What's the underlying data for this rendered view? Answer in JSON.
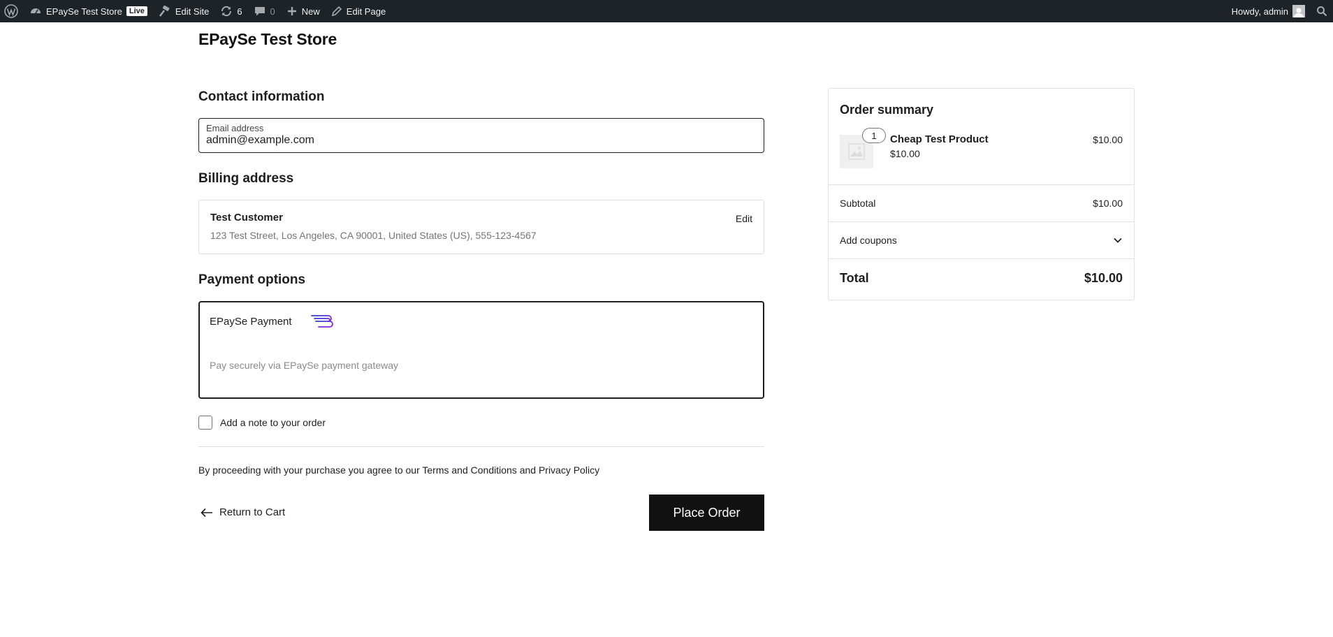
{
  "admin_bar": {
    "site_name": "EPaySe Test Store",
    "live_badge": "Live",
    "edit_site": "Edit Site",
    "updates_count": "6",
    "comments_count": "0",
    "new_label": "New",
    "edit_page": "Edit Page",
    "howdy": "Howdy, admin"
  },
  "store": {
    "title": "EPaySe Test Store"
  },
  "contact": {
    "heading": "Contact information",
    "email_label": "Email address",
    "email_value": "admin@example.com"
  },
  "billing": {
    "heading": "Billing address",
    "name": "Test Customer",
    "address": "123 Test Street, Los Angeles, CA 90001, United States (US), 555-123-4567",
    "edit_label": "Edit"
  },
  "payment": {
    "heading": "Payment options",
    "method_name": "EPaySe Payment",
    "description": "Pay securely via EPaySe payment gateway"
  },
  "order_note": {
    "label": "Add a note to your order",
    "checked": false
  },
  "terms": {
    "prefix": "By proceeding with your purchase you agree to our",
    "terms_link": "Terms and Conditions",
    "and": "and",
    "privacy_link": "Privacy Policy"
  },
  "actions": {
    "return_label": "Return to Cart",
    "place_order_label": "Place Order"
  },
  "summary": {
    "heading": "Order summary",
    "items": [
      {
        "quantity": "1",
        "name": "Cheap Test Product",
        "unit_price": "$10.00",
        "line_total": "$10.00"
      }
    ],
    "subtotal_label": "Subtotal",
    "subtotal_value": "$10.00",
    "coupons_label": "Add coupons",
    "total_label": "Total",
    "total_value": "$10.00"
  },
  "colors": {
    "admin_bar_bg": "#1d2327",
    "primary_button": "#111111",
    "payment_logo_gradient": [
      "#2f3bd6",
      "#a020e0"
    ]
  }
}
